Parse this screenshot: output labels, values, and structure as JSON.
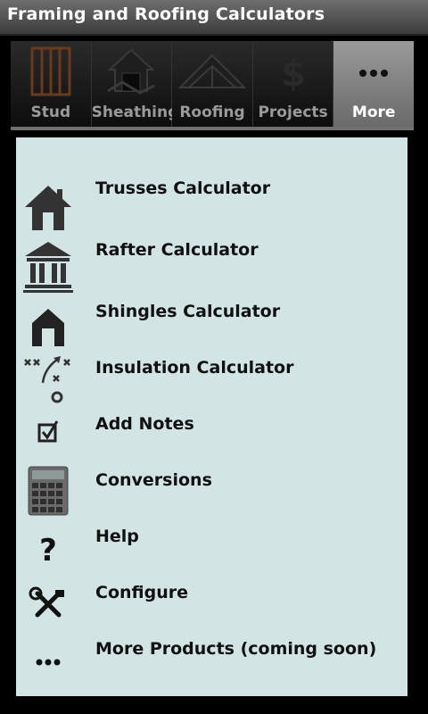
{
  "app": {
    "title": "Framing and Roofing Calculators"
  },
  "tabs": [
    {
      "label": "Stud",
      "icon": "stud-frame-icon",
      "active": false
    },
    {
      "label": "Sheathing",
      "icon": "house-sheathing-icon",
      "active": false
    },
    {
      "label": "Roofing",
      "icon": "roof-icon",
      "active": false
    },
    {
      "label": "Projects",
      "icon": "dollar-icon",
      "active": false
    },
    {
      "label": "More",
      "icon": "more-dots-icon",
      "active": true
    }
  ],
  "menu": {
    "items": [
      {
        "label": "Trusses Calculator",
        "icon": "house-icon"
      },
      {
        "label": "Rafter Calculator",
        "icon": "bank-building-icon"
      },
      {
        "label": "Shingles Calculator",
        "icon": "shingle-house-icon"
      },
      {
        "label": "Insulation Calculator",
        "icon": "play-diagram-icon"
      },
      {
        "label": "Add Notes",
        "icon": "checkbox-icon"
      },
      {
        "label": "Conversions",
        "icon": "calculator-icon"
      },
      {
        "label": "Help",
        "icon": "question-icon"
      },
      {
        "label": "Configure",
        "icon": "tools-icon"
      },
      {
        "label": "More Products (coming soon)",
        "icon": "more-dots-icon"
      }
    ]
  }
}
